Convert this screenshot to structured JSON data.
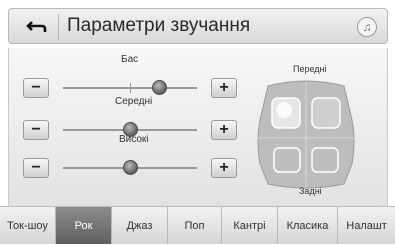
{
  "header": {
    "title": "Параметри звучання",
    "back_icon": "back-arrow-icon",
    "music_icon": "music-note-icon",
    "music_glyph": "♫"
  },
  "sliders": [
    {
      "label": "Бас",
      "minus": "−",
      "plus": "+",
      "level": 0.72
    },
    {
      "label": "Середні",
      "minus": "−",
      "plus": "+",
      "level": 0.5
    },
    {
      "label": "Високі",
      "minus": "−",
      "plus": "+",
      "level": 0.5
    }
  ],
  "fader": {
    "front_label": "Передні",
    "rear_label": "Задні",
    "focus": "front-left"
  },
  "tabs": [
    {
      "label": "Ток-шоу",
      "active": false
    },
    {
      "label": "Рок",
      "active": true
    },
    {
      "label": "Джаз",
      "active": false
    },
    {
      "label": "Поп",
      "active": false
    },
    {
      "label": "Кантрі",
      "active": false
    },
    {
      "label": "Класика",
      "active": false
    },
    {
      "label": "Налашт",
      "active": false
    }
  ],
  "colors": {
    "active_tab": "#6f6f6f",
    "knob": "#5e5e5e"
  }
}
